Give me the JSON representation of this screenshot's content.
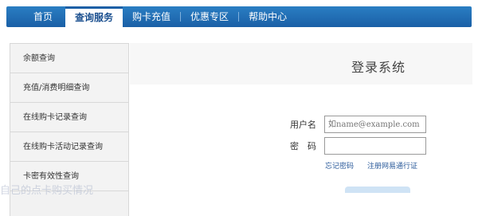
{
  "nav": {
    "items": [
      {
        "label": "首页"
      },
      {
        "label": "查询服务"
      },
      {
        "label": "购卡充值"
      },
      {
        "label": "优惠专区"
      },
      {
        "label": "帮助中心"
      }
    ]
  },
  "sidebar": {
    "items": [
      {
        "label": "余额查询"
      },
      {
        "label": "充值/消费明细查询"
      },
      {
        "label": "在线购卡记录查询"
      },
      {
        "label": "在线购卡活动记录查询"
      },
      {
        "label": "卡密有效性查询"
      }
    ]
  },
  "main": {
    "title": "登录系统",
    "username_label": "用户名",
    "username_placeholder": "如name@example.com",
    "password_label": "密　码",
    "forgot_link": "忘记密码",
    "register_link": "注册网易通行证"
  },
  "watermark": "自己的点卡购买情况"
}
